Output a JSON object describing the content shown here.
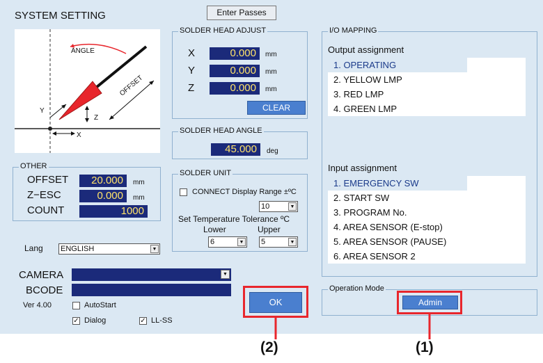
{
  "title": "SYSTEM SETTING",
  "enter_passes": "Enter Passes",
  "diagram": {
    "angle": "ANGLE",
    "offset": "OFFSET",
    "x": "X",
    "y": "Y",
    "z": "Z"
  },
  "other": {
    "legend": "OTHER",
    "offset_label": "OFFSET",
    "offset_value": "20.000",
    "offset_unit": "mm",
    "zesc_label": "Z−ESC",
    "zesc_value": "0.000",
    "zesc_unit": "mm",
    "count_label": "COUNT",
    "count_value": "1000"
  },
  "lang": {
    "label": "Lang",
    "value": "ENGLISH"
  },
  "camera": {
    "label": "CAMERA",
    "value": ""
  },
  "bcode": {
    "label": "BCODE",
    "value": ""
  },
  "version": "Ver 4.00",
  "checkboxes": {
    "autostart": "AutoStart",
    "dialog": "Dialog",
    "llss": "LL-SS",
    "check": "✓"
  },
  "solder_head_adjust": {
    "legend": "SOLDER HEAD ADJUST",
    "x_label": "X",
    "x_value": "0.000",
    "y_label": "Y",
    "y_value": "0.000",
    "z_label": "Z",
    "z_value": "0.000",
    "unit": "mm",
    "clear": "CLEAR"
  },
  "solder_head_angle": {
    "legend": "SOLDER HEAD ANGLE",
    "value": "45.000",
    "unit": "deg"
  },
  "solder_unit": {
    "legend": "SOLDER UNIT",
    "connect_label": "CONNECT Display Range ±ºC",
    "range_value": "10",
    "tolerance_label": "Set Temperature Tolerance ºC",
    "lower_label": "Lower",
    "upper_label": "Upper",
    "lower_value": "6",
    "upper_value": "5"
  },
  "ok": "OK",
  "io_mapping": {
    "legend": "I/O MAPPING",
    "output_title": "Output assignment",
    "outputs": [
      "1. OPERATING",
      "2. YELLOW LMP",
      "3. RED LMP",
      "4. GREEN LMP"
    ],
    "input_title": "Input assignment",
    "inputs": [
      "1. EMERGENCY SW",
      "2. START SW",
      "3. PROGRAM No.",
      "4. AREA SENSOR (E-stop)",
      "5. AREA SENSOR (PAUSE)",
      "6. AREA SENSOR 2"
    ]
  },
  "operation_mode": {
    "legend": "Operation Mode",
    "button": "Admin"
  },
  "annotations": {
    "ok_marker": "(2)",
    "admin_marker": "(1)"
  },
  "colors": {
    "panel": "#dbe8f3",
    "value_bg": "#1b2a7a",
    "value_text": "#ffe36a",
    "button": "#4a7fcf",
    "highlight": "#e8262c"
  }
}
